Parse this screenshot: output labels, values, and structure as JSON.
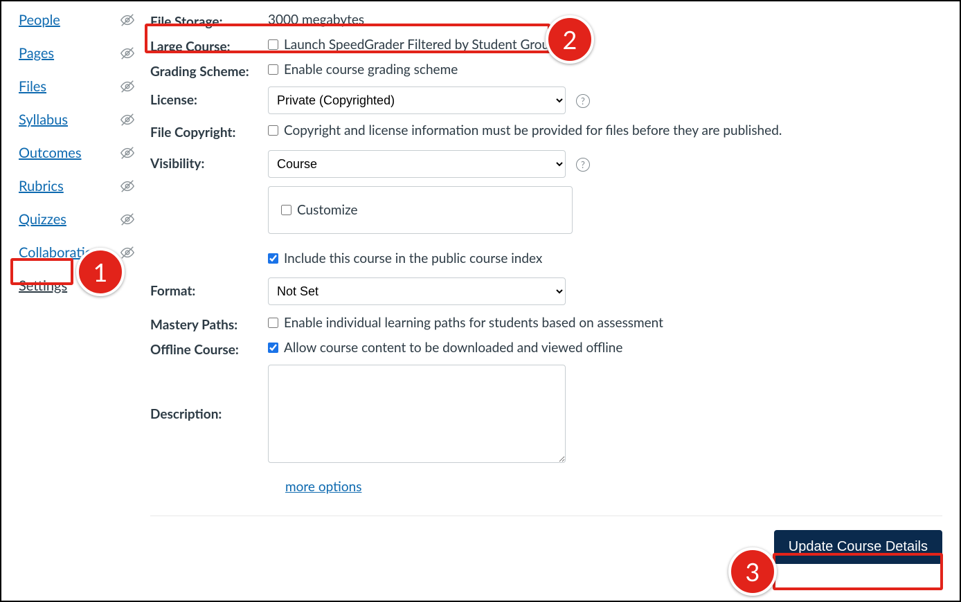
{
  "nav": {
    "items": [
      {
        "label": "People",
        "hidden": true
      },
      {
        "label": "Pages",
        "hidden": true
      },
      {
        "label": "Files",
        "hidden": true
      },
      {
        "label": "Syllabus",
        "hidden": true
      },
      {
        "label": "Outcomes",
        "hidden": true
      },
      {
        "label": "Rubrics",
        "hidden": true
      },
      {
        "label": "Quizzes",
        "hidden": true
      },
      {
        "label": "Collaborations",
        "hidden": true
      },
      {
        "label": "Settings",
        "hidden": false,
        "active": true
      }
    ]
  },
  "form": {
    "file_storage_label": "File Storage:",
    "file_storage_value": "3000 megabytes",
    "large_course_label": "Large Course:",
    "large_course_option": "Launch SpeedGrader Filtered by Student Group",
    "grading_scheme_label": "Grading Scheme:",
    "grading_scheme_option": "Enable course grading scheme",
    "license_label": "License:",
    "license_selected": "Private (Copyrighted)",
    "file_copyright_label": "File Copyright:",
    "file_copyright_option": "Copyright and license information must be provided for files before they are published.",
    "visibility_label": "Visibility:",
    "visibility_selected": "Course",
    "customize_label": "Customize",
    "include_public_index": "Include this course in the public course index",
    "format_label": "Format:",
    "format_selected": "Not Set",
    "mastery_label": "Mastery Paths:",
    "mastery_option": "Enable individual learning paths for students based on assessment",
    "offline_label": "Offline Course:",
    "offline_option": "Allow course content to be downloaded and viewed offline",
    "description_label": "Description:",
    "more_options": "more options",
    "update_button": "Update Course Details"
  },
  "callouts": {
    "c1": "1",
    "c2": "2",
    "c3": "3"
  }
}
